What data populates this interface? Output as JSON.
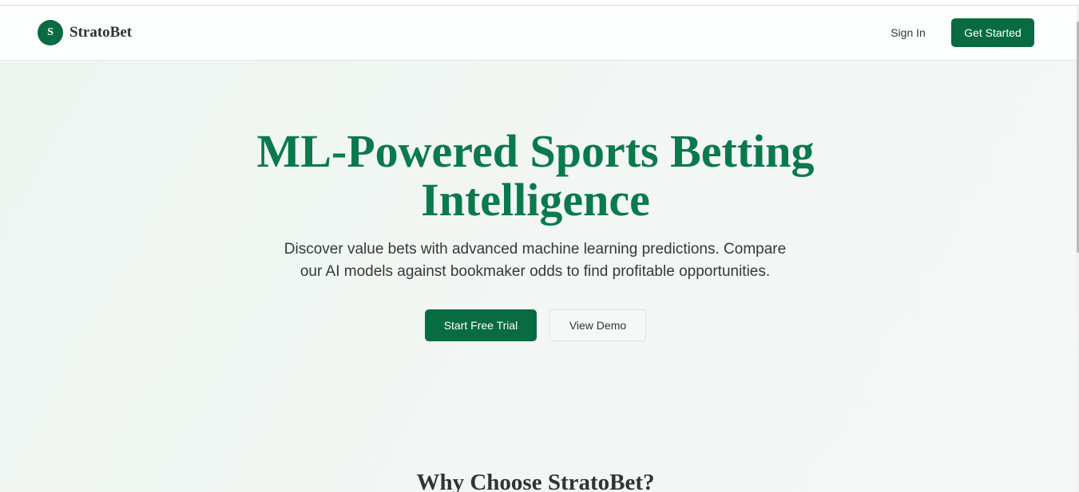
{
  "brand": {
    "badge_letter": "S",
    "name": "StratoBet"
  },
  "nav": {
    "sign_in": "Sign In",
    "get_started": "Get Started"
  },
  "hero": {
    "title_line1": "ML-Powered Sports Betting",
    "title_line2": "Intelligence",
    "subtitle_line1": "Discover value bets with advanced machine learning predictions. Compare",
    "subtitle_line2": "our AI models against bookmaker odds to find profitable opportunities.",
    "primary_cta": "Start Free Trial",
    "secondary_cta": "View Demo"
  },
  "section": {
    "why_title": "Why Choose StratoBet?"
  },
  "colors": {
    "brand_green": "#086b42",
    "title_green": "#0a7a4c",
    "hero_bg": "#eef5f1"
  }
}
